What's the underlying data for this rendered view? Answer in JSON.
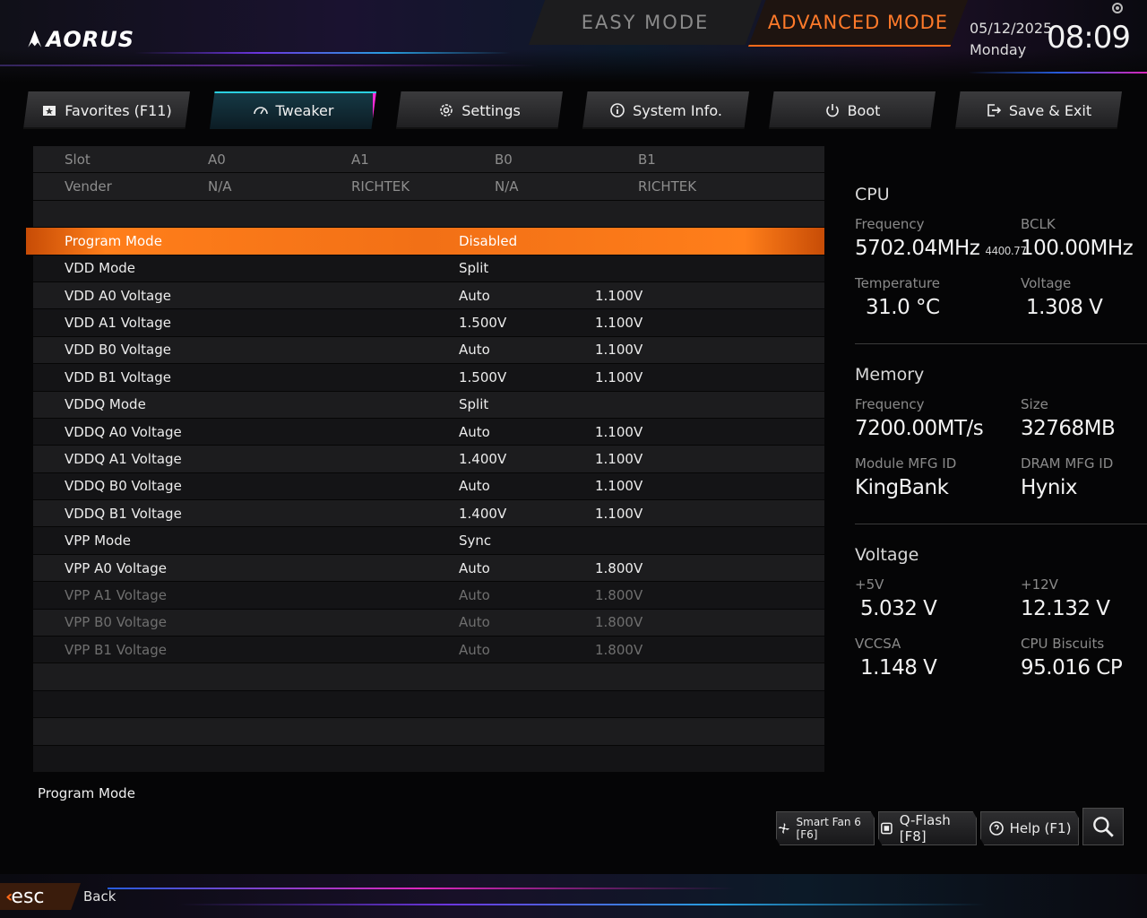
{
  "header": {
    "brand": "AORUS",
    "easy_mode": "EASY MODE",
    "advanced_mode": "ADVANCED MODE",
    "date": "05/12/2025",
    "day": "Monday",
    "time": "08:09"
  },
  "tabs": [
    {
      "label": "Favorites (F11)",
      "icon": "star-folder-icon"
    },
    {
      "label": "Tweaker",
      "icon": "speedometer-icon",
      "active": true
    },
    {
      "label": "Settings",
      "icon": "gear-icon"
    },
    {
      "label": "System Info.",
      "icon": "info-icon"
    },
    {
      "label": "Boot",
      "icon": "power-icon"
    },
    {
      "label": "Save & Exit",
      "icon": "exit-icon"
    }
  ],
  "table": {
    "header_row": [
      "Slot",
      "A0",
      "A1",
      "B0",
      "B1"
    ],
    "vendor_row": [
      "Vender",
      "N/A",
      "RICHTEK",
      "N/A",
      "RICHTEK"
    ],
    "rows": [
      {
        "name": "Program Mode",
        "value": "Disabled",
        "current": "",
        "selected": true
      },
      {
        "name": "VDD Mode",
        "value": "Split",
        "current": ""
      },
      {
        "name": "VDD A0 Voltage",
        "value": "Auto",
        "current": "1.100V"
      },
      {
        "name": "VDD A1 Voltage",
        "value": "1.500V",
        "current": "1.100V"
      },
      {
        "name": "VDD B0 Voltage",
        "value": "Auto",
        "current": "1.100V"
      },
      {
        "name": "VDD B1 Voltage",
        "value": "1.500V",
        "current": "1.100V"
      },
      {
        "name": "VDDQ Mode",
        "value": "Split",
        "current": ""
      },
      {
        "name": "VDDQ A0 Voltage",
        "value": "Auto",
        "current": "1.100V"
      },
      {
        "name": "VDDQ A1 Voltage",
        "value": "1.400V",
        "current": "1.100V"
      },
      {
        "name": "VDDQ B0 Voltage",
        "value": "Auto",
        "current": "1.100V"
      },
      {
        "name": "VDDQ B1 Voltage",
        "value": "1.400V",
        "current": "1.100V"
      },
      {
        "name": "VPP Mode",
        "value": "Sync",
        "current": ""
      },
      {
        "name": "VPP A0 Voltage",
        "value": "Auto",
        "current": "1.800V"
      },
      {
        "name": "VPP A1 Voltage",
        "value": "Auto",
        "current": "1.800V",
        "dim": true
      },
      {
        "name": "VPP B0 Voltage",
        "value": "Auto",
        "current": "1.800V",
        "dim": true
      },
      {
        "name": "VPP B1 Voltage",
        "value": "Auto",
        "current": "1.800V",
        "dim": true
      }
    ]
  },
  "info": {
    "cpu": {
      "title": "CPU",
      "freq_label": "Frequency",
      "freq": "5702.04MHz",
      "freq_sub": "4400.77",
      "bclk_label": "BCLK",
      "bclk": "100.00MHz",
      "temp_label": "Temperature",
      "temp": "31.0 °C",
      "volt_label": "Voltage",
      "volt": "1.308 V"
    },
    "memory": {
      "title": "Memory",
      "freq_label": "Frequency",
      "freq": "7200.00MT/s",
      "size_label": "Size",
      "size": "32768MB",
      "module_label": "Module MFG ID",
      "module": "KingBank",
      "dram_label": "DRAM MFG ID",
      "dram": "Hynix"
    },
    "voltage": {
      "title": "Voltage",
      "v5_label": "+5V",
      "v5": "5.032 V",
      "v12_label": "+12V",
      "v12": "12.132 V",
      "vccsa_label": "VCCSA",
      "vccsa": "1.148 V",
      "biscuits_label": "CPU Biscuits",
      "biscuits": "95.016 CP"
    }
  },
  "description": "Program Mode",
  "footer": {
    "smart_fan": "Smart Fan 6 [F6]",
    "qflash": "Q-Flash [F8]",
    "help": "Help (F1)",
    "esc": "esc",
    "back": "Back"
  },
  "colors": {
    "accent": "#ff7a1a",
    "tab_active": "#2bd0e0",
    "tab_active_edge": "#ff2bd8"
  }
}
